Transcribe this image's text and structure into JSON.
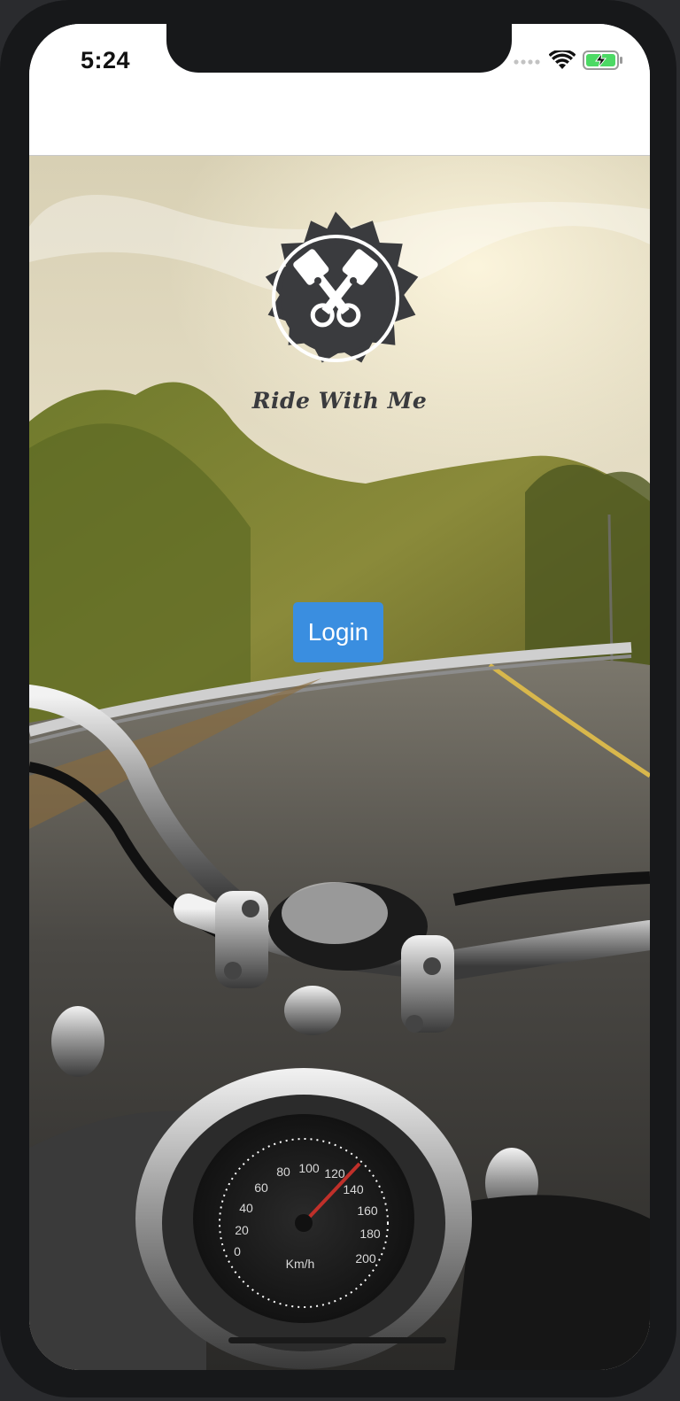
{
  "status_bar": {
    "time": "5:24",
    "icons": [
      "signal-icon",
      "wifi-icon",
      "battery-charging-icon"
    ]
  },
  "brand": {
    "name": "Ride With Me",
    "logo_icon": "pistons-badge-icon"
  },
  "login_button": {
    "label": "Login"
  },
  "colors": {
    "button": "#3a8ee0",
    "logo": "#3a3b3e",
    "battery": "#4cd964"
  }
}
